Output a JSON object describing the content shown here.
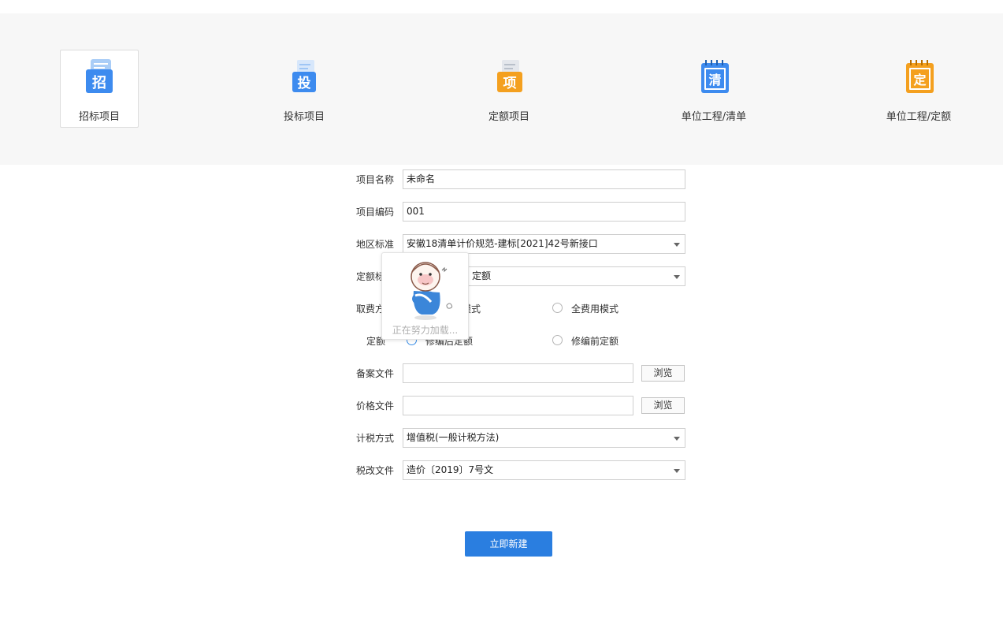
{
  "project_types": [
    {
      "label": "招标项目",
      "icon_char": "招",
      "icon": "tender-doc-icon",
      "color": "#3d8bef",
      "selected": true
    },
    {
      "label": "投标项目",
      "icon_char": "投",
      "icon": "bid-doc-icon",
      "color": "#3d8bef",
      "selected": false
    },
    {
      "label": "定额项目",
      "icon_char": "项",
      "icon": "quota-project-icon",
      "color": "#f4a01f",
      "selected": false
    },
    {
      "label": "单位工程/清单",
      "icon_char": "清",
      "icon": "unit-list-notebook-icon",
      "color": "#3d8bef",
      "selected": false
    },
    {
      "label": "单位工程/定额",
      "icon_char": "定",
      "icon": "unit-quota-notebook-icon",
      "color": "#f4a01f",
      "selected": false
    }
  ],
  "form": {
    "project_name": {
      "label": "项目名称",
      "value": "未命名"
    },
    "project_code": {
      "label": "项目编码",
      "value": "001"
    },
    "region_standard": {
      "label": "地区标准",
      "value": "安徽18清单计价规范-建标[2021]42号新接口"
    },
    "quota_standard": {
      "label": "定额标准",
      "value": "定额"
    },
    "fee_mode": {
      "label": "取费方式",
      "option1": "模式",
      "option2": "全费用模式",
      "selected": 1
    },
    "quota_version": {
      "label": "定额",
      "option1": "修编后定额",
      "option2": "修编前定额",
      "selected": 1
    },
    "filing_file": {
      "label": "备案文件",
      "value": "",
      "browse": "浏览"
    },
    "price_file": {
      "label": "价格文件",
      "value": "",
      "browse": "浏览"
    },
    "tax_method": {
      "label": "计税方式",
      "value": "增值税(一般计税方法)"
    },
    "tax_reform_file": {
      "label": "税改文件",
      "value": "造价〔2019〕7号文"
    }
  },
  "loading": {
    "text": "正在努力加载...",
    "icon": "mascot-loading-icon"
  },
  "actions": {
    "create_label": "立即新建"
  },
  "colors": {
    "primary": "#2a7ee0",
    "blue_icon": "#3d8bef",
    "orange_icon": "#f4a01f",
    "band": "#f7f7f7"
  }
}
